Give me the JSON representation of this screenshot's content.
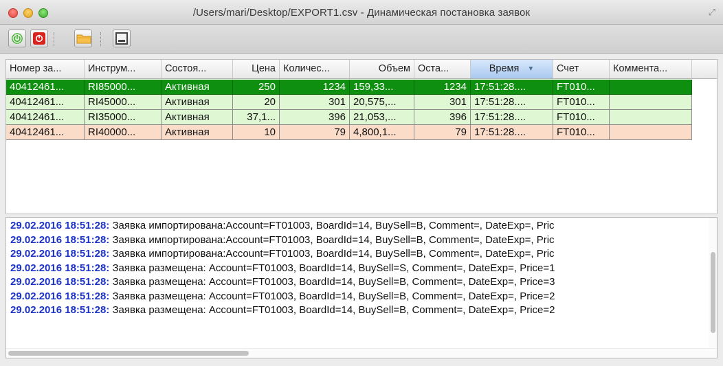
{
  "window": {
    "title": "/Users/mari/Desktop/EXPORT1.csv - Динамическая постановка заявок"
  },
  "toolbar": {
    "buttons": [
      {
        "name": "start",
        "icon": "power-icon",
        "color": "#3aa82a"
      },
      {
        "name": "stop",
        "icon": "stop-icon",
        "color": "#d8221d"
      },
      {
        "name": "open",
        "icon": "folder-icon",
        "color": "#f2b53a"
      },
      {
        "name": "window",
        "icon": "window-icon",
        "color": "#444444"
      }
    ]
  },
  "table": {
    "columns": [
      "Номер за...",
      "Инструм...",
      "Состоя...",
      "Цена",
      "Количес...",
      "Объем",
      "Оста...",
      "Время",
      "Счет",
      "Коммента..."
    ],
    "sorted_column": "Время",
    "rows": [
      {
        "cells": [
          "40412461...",
          "RI85000...",
          "Активная",
          "250",
          "1234",
          "159,33...",
          "1234",
          "17:51:28....",
          "FT010...",
          ""
        ],
        "style": "selected",
        "color": "#0f8f0f"
      },
      {
        "cells": [
          "40412461...",
          "RI45000...",
          "Активная",
          "20",
          "301",
          "20,575,...",
          "301",
          "17:51:28....",
          "FT010...",
          ""
        ],
        "style": "buy",
        "color": "#dff7d2"
      },
      {
        "cells": [
          "40412461...",
          "RI35000...",
          "Активная",
          "37,1...",
          "396",
          "21,053,...",
          "396",
          "17:51:28....",
          "FT010...",
          ""
        ],
        "style": "buy",
        "color": "#dff7d2"
      },
      {
        "cells": [
          "40412461...",
          "RI40000...",
          "Активная",
          "10",
          "79",
          "4,800,1...",
          "79",
          "17:51:28....",
          "FT010...",
          ""
        ],
        "style": "sell",
        "color": "#fbdcc9"
      }
    ]
  },
  "log": {
    "lines": [
      {
        "ts": "29.02.2016 18:51:28:",
        "text": " Заявка импортирована:Account=FT01003, BoardId=14, BuySell=B, Comment=, DateExp=, Pric"
      },
      {
        "ts": "29.02.2016 18:51:28:",
        "text": " Заявка импортирована:Account=FT01003, BoardId=14, BuySell=B, Comment=, DateExp=, Pric"
      },
      {
        "ts": "29.02.2016 18:51:28:",
        "text": " Заявка импортирована:Account=FT01003, BoardId=14, BuySell=B, Comment=, DateExp=, Pric"
      },
      {
        "ts": "29.02.2016 18:51:28:",
        "text": " Заявка размещена: Account=FT01003, BoardId=14, BuySell=S, Comment=, DateExp=, Price=1"
      },
      {
        "ts": "29.02.2016 18:51:28:",
        "text": " Заявка размещена: Account=FT01003, BoardId=14, BuySell=B, Comment=, DateExp=, Price=3"
      },
      {
        "ts": "29.02.2016 18:51:28:",
        "text": " Заявка размещена: Account=FT01003, BoardId=14, BuySell=B, Comment=, DateExp=, Price=2"
      },
      {
        "ts": "29.02.2016 18:51:28:",
        "text": " Заявка размещена: Account=FT01003, BoardId=14, BuySell=B, Comment=, DateExp=, Price=2"
      }
    ]
  }
}
